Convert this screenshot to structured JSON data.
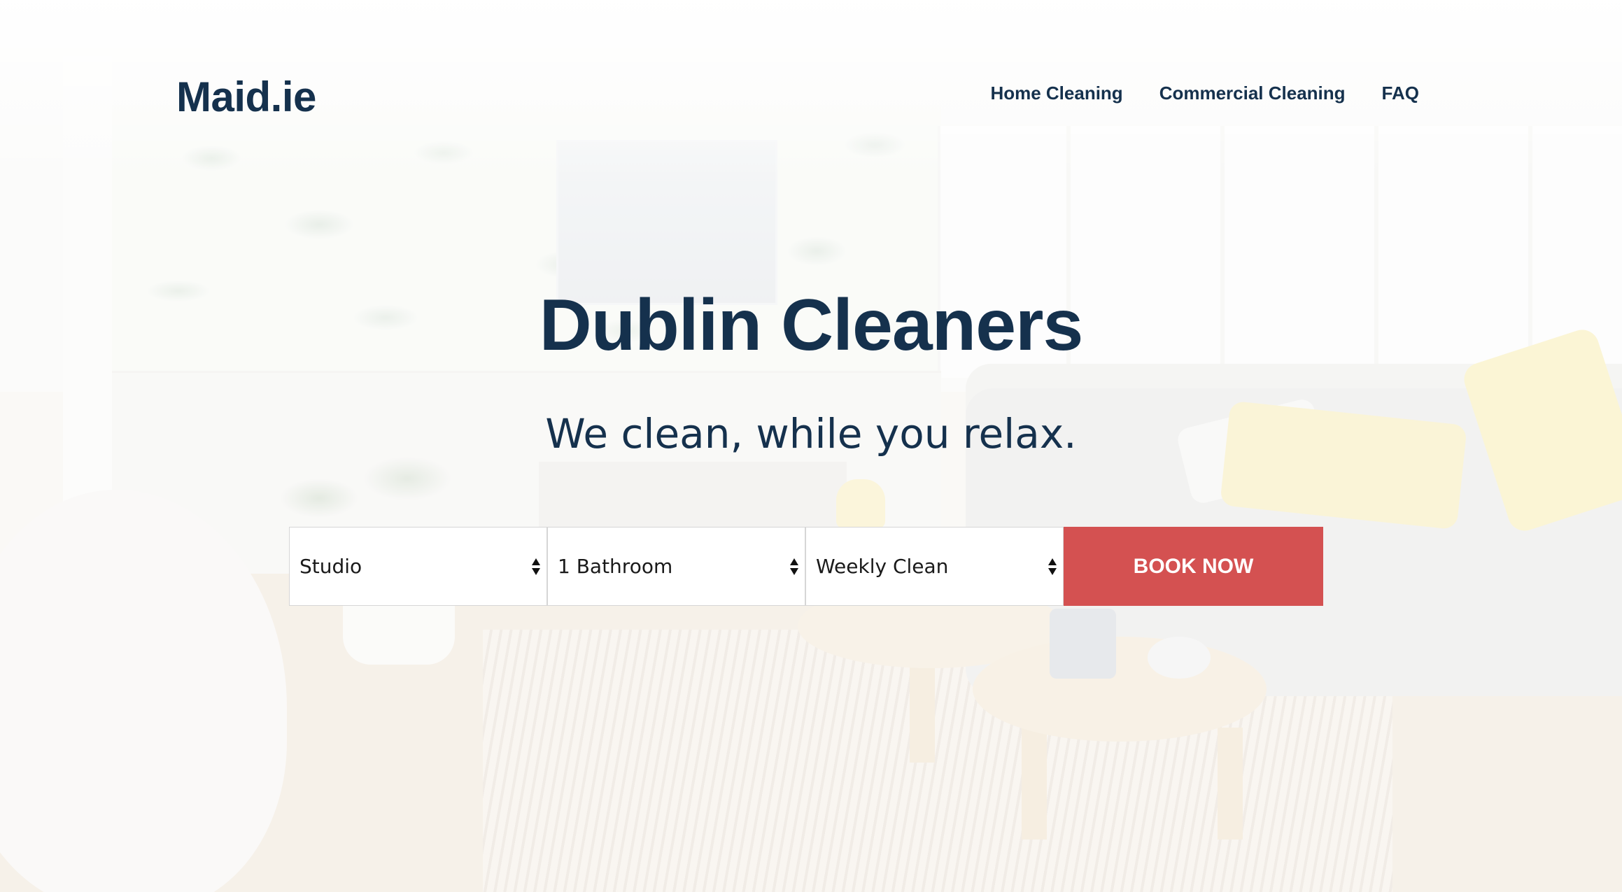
{
  "header": {
    "logo": "Maid.ie",
    "nav": [
      {
        "label": "Home Cleaning"
      },
      {
        "label": "Commercial Cleaning"
      },
      {
        "label": "FAQ"
      }
    ]
  },
  "hero": {
    "title": "Dublin Cleaners",
    "subtitle": "We clean, while you relax."
  },
  "booking": {
    "property_size": "Studio",
    "bathrooms": "1 Bathroom",
    "frequency": "Weekly Clean",
    "cta": "BOOK NOW"
  },
  "colors": {
    "brand_navy": "#15314d",
    "cta_red": "#d45151"
  },
  "icons": {
    "select_arrows": "up-down-arrows-icon"
  }
}
